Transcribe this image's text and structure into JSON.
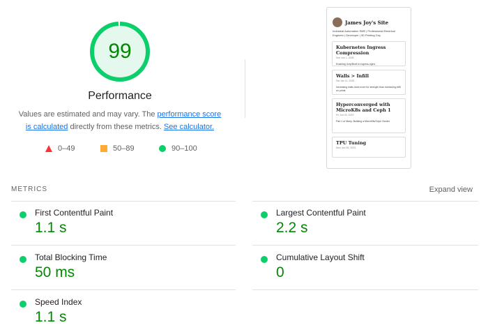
{
  "gauge": {
    "score": "99",
    "score_fraction": 0.99,
    "ring_color": "#0cce6b",
    "fill_color": "#e5f8ee",
    "text_color": "#008800"
  },
  "performance": {
    "title": "Performance",
    "desc_part1": "Values are estimated and may vary. The ",
    "desc_link1": "performance score is calculated",
    "desc_part2": " directly from these metrics. ",
    "desc_link2": "See calculator."
  },
  "legend": [
    {
      "shape": "triangle",
      "color": "#ff3333",
      "range": "0–49"
    },
    {
      "shape": "square",
      "color": "#ffaa33",
      "range": "50–89"
    },
    {
      "shape": "circle",
      "color": "#0cce6b",
      "range": "90–100"
    }
  ],
  "screenshot_preview": {
    "site_title": "James Joy's Site",
    "tagline": "Industrial Automation SME | Professional Electrical Engineer | Developer | 3D Printing Guy",
    "posts": [
      {
        "title": "Kubernetes Ingress Compression",
        "date": "Sun Jun 1, 2025",
        "excerpt": "Enabling Gzip/Brotli in ingress-nginx"
      },
      {
        "title": "Walls > Infill",
        "date": "Sat Jan 11, 2025",
        "excerpt": "Increasing walls does more for strength than increasing infill on prints."
      },
      {
        "title": "Hyperconverged with MicroK8s and Ceph 1",
        "date": "Fri Jun 09, 2023",
        "excerpt": "Part 1 of Many: Building a MicroK8s/Ceph Cluster"
      },
      {
        "title": "TPU Tuning",
        "date": "Mon Jun 05, 2023",
        "excerpt": ""
      }
    ]
  },
  "metrics": {
    "section_label": "METRICS",
    "expand_label": "Expand view",
    "items": [
      {
        "name": "First Contentful Paint",
        "value": "1.1 s"
      },
      {
        "name": "Largest Contentful Paint",
        "value": "2.2 s"
      },
      {
        "name": "Total Blocking Time",
        "value": "50 ms"
      },
      {
        "name": "Cumulative Layout Shift",
        "value": "0"
      },
      {
        "name": "Speed Index",
        "value": "1.1 s"
      }
    ]
  }
}
